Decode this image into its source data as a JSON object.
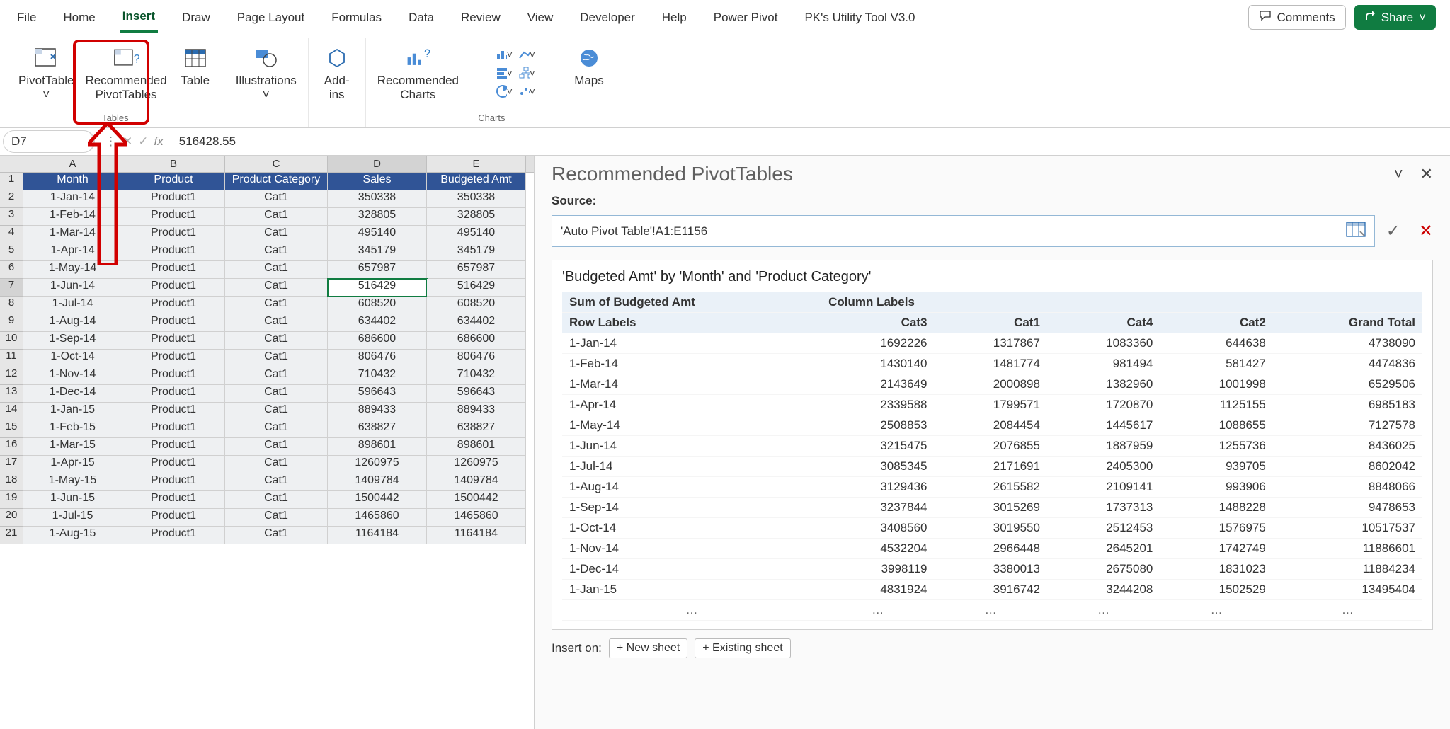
{
  "ribbon": {
    "tabs": [
      "File",
      "Home",
      "Insert",
      "Draw",
      "Page Layout",
      "Formulas",
      "Data",
      "Review",
      "View",
      "Developer",
      "Help",
      "Power Pivot",
      "PK's Utility Tool V3.0"
    ],
    "active_tab": "Insert",
    "comments": "Comments",
    "share": "Share"
  },
  "toolbar": {
    "pivot": "PivotTable",
    "recpivot1": "Recommended",
    "recpivot2": "PivotTables",
    "table": "Table",
    "group_tables": "Tables",
    "illustrations": "Illustrations",
    "addins1": "Add-",
    "addins2": "ins",
    "reccharts1": "Recommended",
    "reccharts2": "Charts",
    "maps": "Maps",
    "group_charts": "Charts"
  },
  "formula_bar": {
    "name_box": "D7",
    "fx": "fx",
    "value": "516428.55"
  },
  "columns": [
    "",
    "A",
    "B",
    "C",
    "D",
    "E"
  ],
  "sheet_headers": [
    "Month",
    "Product",
    "Product Category",
    "Sales",
    "Budgeted Amt"
  ],
  "sheet_rows": [
    {
      "n": 2,
      "a": "1-Jan-14",
      "b": "Product1",
      "c": "Cat1",
      "d": "350338",
      "e": "350338"
    },
    {
      "n": 3,
      "a": "1-Feb-14",
      "b": "Product1",
      "c": "Cat1",
      "d": "328805",
      "e": "328805"
    },
    {
      "n": 4,
      "a": "1-Mar-14",
      "b": "Product1",
      "c": "Cat1",
      "d": "495140",
      "e": "495140"
    },
    {
      "n": 5,
      "a": "1-Apr-14",
      "b": "Product1",
      "c": "Cat1",
      "d": "345179",
      "e": "345179"
    },
    {
      "n": 6,
      "a": "1-May-14",
      "b": "Product1",
      "c": "Cat1",
      "d": "657987",
      "e": "657987"
    },
    {
      "n": 7,
      "a": "1-Jun-14",
      "b": "Product1",
      "c": "Cat1",
      "d": "516429",
      "e": "516429",
      "active": true
    },
    {
      "n": 8,
      "a": "1-Jul-14",
      "b": "Product1",
      "c": "Cat1",
      "d": "608520",
      "e": "608520"
    },
    {
      "n": 9,
      "a": "1-Aug-14",
      "b": "Product1",
      "c": "Cat1",
      "d": "634402",
      "e": "634402"
    },
    {
      "n": 10,
      "a": "1-Sep-14",
      "b": "Product1",
      "c": "Cat1",
      "d": "686600",
      "e": "686600"
    },
    {
      "n": 11,
      "a": "1-Oct-14",
      "b": "Product1",
      "c": "Cat1",
      "d": "806476",
      "e": "806476"
    },
    {
      "n": 12,
      "a": "1-Nov-14",
      "b": "Product1",
      "c": "Cat1",
      "d": "710432",
      "e": "710432"
    },
    {
      "n": 13,
      "a": "1-Dec-14",
      "b": "Product1",
      "c": "Cat1",
      "d": "596643",
      "e": "596643"
    },
    {
      "n": 14,
      "a": "1-Jan-15",
      "b": "Product1",
      "c": "Cat1",
      "d": "889433",
      "e": "889433"
    },
    {
      "n": 15,
      "a": "1-Feb-15",
      "b": "Product1",
      "c": "Cat1",
      "d": "638827",
      "e": "638827"
    },
    {
      "n": 16,
      "a": "1-Mar-15",
      "b": "Product1",
      "c": "Cat1",
      "d": "898601",
      "e": "898601"
    },
    {
      "n": 17,
      "a": "1-Apr-15",
      "b": "Product1",
      "c": "Cat1",
      "d": "1260975",
      "e": "1260975"
    },
    {
      "n": 18,
      "a": "1-May-15",
      "b": "Product1",
      "c": "Cat1",
      "d": "1409784",
      "e": "1409784"
    },
    {
      "n": 19,
      "a": "1-Jun-15",
      "b": "Product1",
      "c": "Cat1",
      "d": "1500442",
      "e": "1500442"
    },
    {
      "n": 20,
      "a": "1-Jul-15",
      "b": "Product1",
      "c": "Cat1",
      "d": "1465860",
      "e": "1465860"
    },
    {
      "n": 21,
      "a": "1-Aug-15",
      "b": "Product1",
      "c": "Cat1",
      "d": "1164184",
      "e": "1164184"
    }
  ],
  "pane": {
    "title": "Recommended PivotTables",
    "source_label": "Source:",
    "source_value": "'Auto Pivot Table'!A1:E1156",
    "preview_title": "'Budgeted Amt' by 'Month' and 'Product Category'",
    "h_sum": "Sum of Budgeted Amt",
    "h_collabels": "Column Labels",
    "h_rowlabels": "Row Labels",
    "cols": [
      "Cat3",
      "Cat1",
      "Cat4",
      "Cat2",
      "Grand Total"
    ],
    "rows": [
      {
        "label": "1-Jan-14",
        "v": [
          "1692226",
          "1317867",
          "1083360",
          "644638",
          "4738090"
        ]
      },
      {
        "label": "1-Feb-14",
        "v": [
          "1430140",
          "1481774",
          "981494",
          "581427",
          "4474836"
        ]
      },
      {
        "label": "1-Mar-14",
        "v": [
          "2143649",
          "2000898",
          "1382960",
          "1001998",
          "6529506"
        ]
      },
      {
        "label": "1-Apr-14",
        "v": [
          "2339588",
          "1799571",
          "1720870",
          "1125155",
          "6985183"
        ]
      },
      {
        "label": "1-May-14",
        "v": [
          "2508853",
          "2084454",
          "1445617",
          "1088655",
          "7127578"
        ]
      },
      {
        "label": "1-Jun-14",
        "v": [
          "3215475",
          "2076855",
          "1887959",
          "1255736",
          "8436025"
        ]
      },
      {
        "label": "1-Jul-14",
        "v": [
          "3085345",
          "2171691",
          "2405300",
          "939705",
          "8602042"
        ]
      },
      {
        "label": "1-Aug-14",
        "v": [
          "3129436",
          "2615582",
          "2109141",
          "993906",
          "8848066"
        ]
      },
      {
        "label": "1-Sep-14",
        "v": [
          "3237844",
          "3015269",
          "1737313",
          "1488228",
          "9478653"
        ]
      },
      {
        "label": "1-Oct-14",
        "v": [
          "3408560",
          "3019550",
          "2512453",
          "1576975",
          "10517537"
        ]
      },
      {
        "label": "1-Nov-14",
        "v": [
          "4532204",
          "2966448",
          "2645201",
          "1742749",
          "11886601"
        ]
      },
      {
        "label": "1-Dec-14",
        "v": [
          "3998119",
          "3380013",
          "2675080",
          "1831023",
          "11884234"
        ]
      },
      {
        "label": "1-Jan-15",
        "v": [
          "4831924",
          "3916742",
          "3244208",
          "1502529",
          "13495404"
        ]
      }
    ],
    "insert_on": "Insert on:",
    "new_sheet": "+ New sheet",
    "existing_sheet": "+ Existing sheet"
  }
}
